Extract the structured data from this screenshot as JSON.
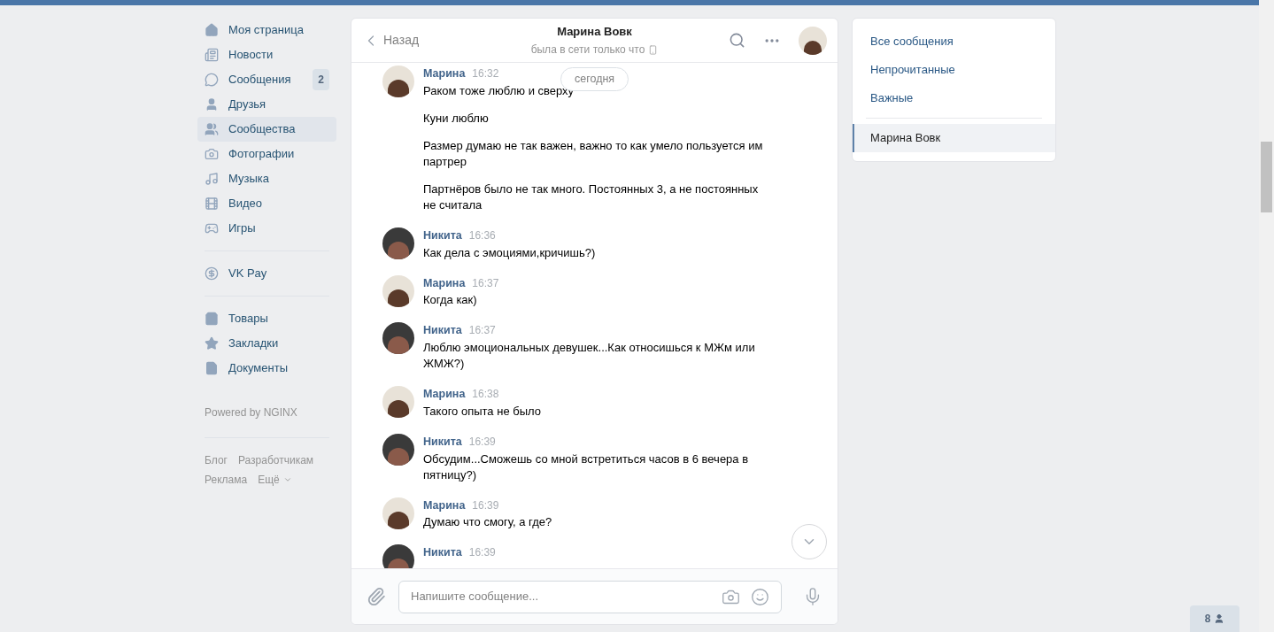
{
  "nav": {
    "items": [
      {
        "kind": "home",
        "label": "Моя страница",
        "selected": false
      },
      {
        "kind": "news",
        "label": "Новости",
        "selected": false
      },
      {
        "kind": "messages",
        "label": "Сообщения",
        "selected": false,
        "badge": "2"
      },
      {
        "kind": "friends",
        "label": "Друзья",
        "selected": false
      },
      {
        "kind": "groups",
        "label": "Сообщества",
        "selected": true
      },
      {
        "kind": "photos",
        "label": "Фотографии",
        "selected": false
      },
      {
        "kind": "music",
        "label": "Музыка",
        "selected": false
      },
      {
        "kind": "video",
        "label": "Видео",
        "selected": false
      },
      {
        "kind": "games",
        "label": "Игры",
        "selected": false
      },
      {
        "kind": "divider"
      },
      {
        "kind": "pay",
        "label": "VK Pay",
        "selected": false
      },
      {
        "kind": "divider"
      },
      {
        "kind": "market",
        "label": "Товары",
        "selected": false
      },
      {
        "kind": "bookmarks",
        "label": "Закладки",
        "selected": false
      },
      {
        "kind": "docs",
        "label": "Документы",
        "selected": false
      }
    ],
    "powered": "Powered by NGINX",
    "footer_links": [
      "Блог",
      "Разработчикам",
      "Реклама",
      "Ещё"
    ]
  },
  "chat": {
    "back": "Назад",
    "title": "Марина Вовк",
    "status": "была в сети только что",
    "date_pill": "сегодня",
    "messages": [
      {
        "author": "Марина",
        "time": "16:32",
        "lines": [
          "Раком тоже люблю и сверху",
          "Куни люблю",
          "Размер думаю не так важен, важно то как умело пользуется им партрер",
          "Партнёров было не так много. Постоянных 3, а не постоянных не считала"
        ]
      },
      {
        "author": "Никита",
        "time": "16:36",
        "lines": [
          "Как дела с эмоциями,кричишь?)"
        ]
      },
      {
        "author": "Марина",
        "time": "16:37",
        "lines": [
          "Когда как)"
        ]
      },
      {
        "author": "Никита",
        "time": "16:37",
        "lines": [
          "Люблю эмоциональных девушек...Как относишься к МЖм или ЖМЖ?)"
        ]
      },
      {
        "author": "Марина",
        "time": "16:38",
        "lines": [
          "Такого опыта не было"
        ]
      },
      {
        "author": "Никита",
        "time": "16:39",
        "lines": [
          "Обсудим...Сможешь со мной встретиться часов в 6 вечера в пятницу?)"
        ]
      },
      {
        "author": "Марина",
        "time": "16:39",
        "lines": [
          "Думаю что смогу, а где?"
        ]
      },
      {
        "author": "Никита",
        "time": "16:39"
      }
    ],
    "input": {
      "placeholder": "Напишите сообщение..."
    }
  },
  "filters": {
    "items": [
      {
        "label": "Все сообщения",
        "selected": false
      },
      {
        "label": "Непрочитанные",
        "selected": false
      },
      {
        "label": "Важные",
        "selected": false
      }
    ],
    "conversations": [
      {
        "label": "Марина Вовк",
        "selected": true
      }
    ]
  },
  "online_count": "8"
}
